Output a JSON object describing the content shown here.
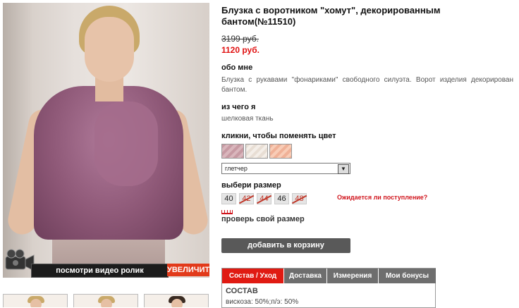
{
  "product": {
    "title": "Блузка с воротником \"хомут\", декорированным бантом(№11510)",
    "old_price": "3199 руб.",
    "new_price": "1120 руб."
  },
  "about": {
    "heading": "обо мне",
    "text": "Блузка с рукавами \"фонариками\" свободного силуэта. Ворот изделия декорирован бантом."
  },
  "material": {
    "heading": "из чего я",
    "text": "шелковая ткань"
  },
  "color": {
    "heading": "кликни, чтобы поменять цвет",
    "swatches": [
      "#c9a0a6",
      "#e9dfd6",
      "#f2b9a0"
    ],
    "selected": "глетчер"
  },
  "size": {
    "heading": "выбери размер",
    "options": [
      {
        "label": "40",
        "available": true
      },
      {
        "label": "42",
        "available": false
      },
      {
        "label": "44",
        "available": false
      },
      {
        "label": "46",
        "available": true
      },
      {
        "label": "48",
        "available": false
      }
    ],
    "wait_link": "Ожидается ли поступление?",
    "check_link": "проверь свой размер"
  },
  "cart_button": "добавить в корзину",
  "media": {
    "video_label": "посмотри видео ролик",
    "zoom_label": "УВЕЛИЧИТЬ"
  },
  "tabs": {
    "items": [
      "Состав / Уход",
      "Доставка",
      "Измерения",
      "Мои бонусы"
    ],
    "active": 0,
    "content_heading": "СОСТАВ",
    "content_text": "вискоза: 50%;п/э: 50%"
  },
  "colors": {
    "accent": "#e01a12",
    "price_red": "#e01010",
    "button_gray": "#595959",
    "tab_gray": "#6e6e6e"
  }
}
